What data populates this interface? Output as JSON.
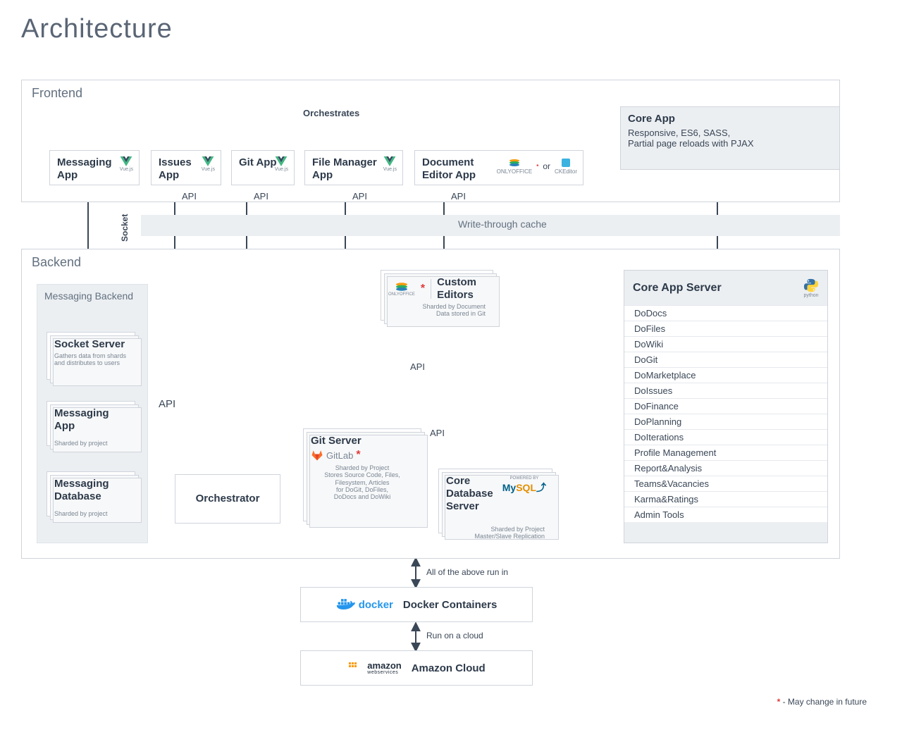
{
  "title": "Architecture",
  "frontend": {
    "title": "Frontend",
    "orchestrates": "Orchestrates",
    "apps": {
      "messaging": {
        "name": "Messaging App",
        "badge": "Vue.js"
      },
      "issues": {
        "name": "Issues App",
        "badge": "Vue.js"
      },
      "git": {
        "name": "Git App",
        "badge": "Vue.js"
      },
      "file": {
        "name": "File Manager App",
        "badge": "Vue.js"
      },
      "doc": {
        "name": "Document Editor App",
        "or": "or",
        "left": "ONLYOFFICE",
        "right": "CKEditor"
      }
    },
    "core_app": {
      "title": "Core App",
      "desc": "Responsive, ES6, SASS,\nPartial page reloads with PJAX"
    },
    "api": "API",
    "socket": "Socket",
    "cache": "Write-through cache"
  },
  "backend": {
    "title": "Backend",
    "messaging_backend": {
      "title": "Messaging Backend",
      "socket_server": {
        "name": "Socket Server",
        "sub": "Gathers data from shards and distributes to users"
      },
      "messaging_app": {
        "name": "Messaging App",
        "sub": "Sharded by project"
      },
      "messaging_db": {
        "name": "Messaging Database",
        "sub": "Sharded by project"
      }
    },
    "orchestrator": "Orchestrator",
    "custom_editors": {
      "name": "Custom Editors",
      "brand": "ONLYOFFICE",
      "sub": "Sharded by Document\nData stored in Git"
    },
    "git_server": {
      "name": "Git Server",
      "brand": "GitLab",
      "sub": "Sharded by Project\nStores Source Code, Files,\nFilesystem, Articles\nfor DoGit, DoFiles,\nDoDocs and DoWiki"
    },
    "core_db": {
      "name": "Core Database Server",
      "powered": "POWERED BY",
      "brand": "MySQL",
      "sub": "Sharded by Project\nMaster/Slave Replication"
    },
    "core_app_server": {
      "title": "Core App Server",
      "lang": "python",
      "items": [
        "DoDocs",
        "DoFiles",
        "DoWiki",
        "DoGit",
        "DoMarketplace",
        "DoIssues",
        "DoFinance",
        "DoPlanning",
        "DoIterations",
        "Profile Management",
        "Report&Analysis",
        "Teams&Vacancies",
        "Karma&Ratings",
        "Admin Tools"
      ]
    },
    "api": "API"
  },
  "footer": {
    "above": "All of the above run in",
    "docker": {
      "brand": "docker",
      "text": "Docker Containers"
    },
    "cloud_label": "Run on a cloud",
    "aws": {
      "brand": "amazon",
      "sub": "webservices",
      "text": "Amazon Cloud"
    }
  },
  "legend": "- May change in future",
  "legend_mark": "*"
}
